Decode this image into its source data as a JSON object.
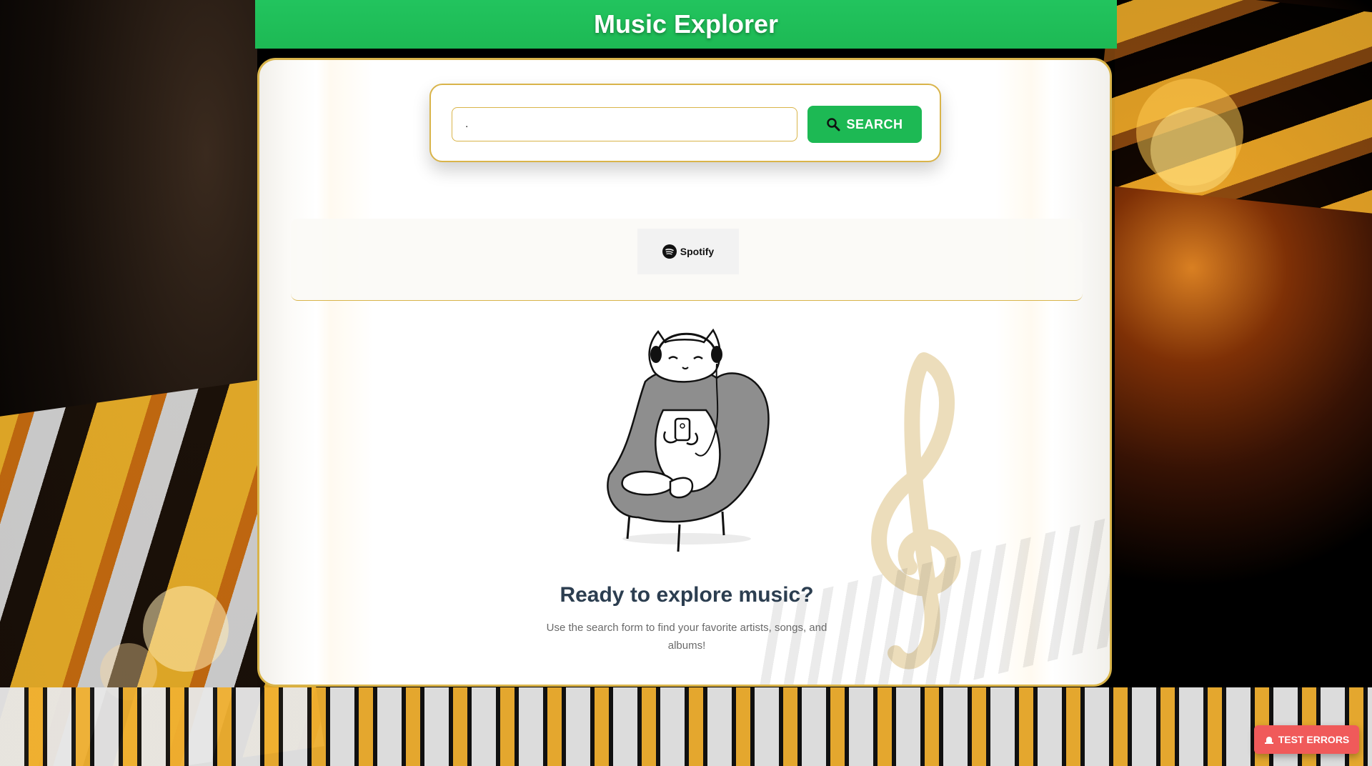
{
  "header": {
    "title": "Music Explorer"
  },
  "search": {
    "value": ".",
    "button_label": "SEARCH"
  },
  "provider": {
    "name": "Spotify"
  },
  "empty_state": {
    "title": "Ready to explore music?",
    "subtitle": "Use the search form to find your favorite artists, songs, and albums!"
  },
  "debug": {
    "test_errors_label": "TEST ERRORS"
  },
  "colors": {
    "brand_green": "#1db954",
    "accent_gold": "#d9b44a",
    "error_red": "#f05a5a",
    "title_text": "#2c3e50"
  }
}
